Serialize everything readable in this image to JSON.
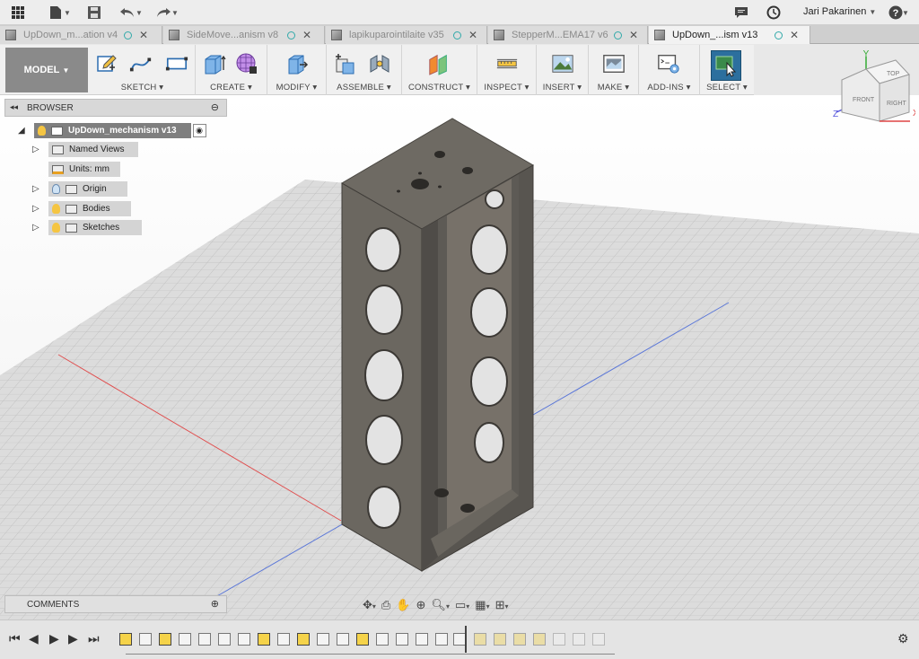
{
  "appbar": {
    "user_name": "Jari Pakarinen",
    "icons": [
      "grid-icon",
      "file-icon",
      "save-icon",
      "undo-icon",
      "redo-icon",
      "comment-icon",
      "clock-icon",
      "help-icon"
    ]
  },
  "tabs": [
    {
      "label": "UpDown_m...ation v4",
      "active": false
    },
    {
      "label": "SideMove...anism v8",
      "active": false
    },
    {
      "label": "lapikuparointilaite v35",
      "active": false
    },
    {
      "label": "StepperM...EMA17 v6",
      "active": false
    },
    {
      "label": "UpDown_...ism v13",
      "active": true
    }
  ],
  "toolbar": {
    "mode_label": "MODEL",
    "groups": [
      "SKETCH",
      "CREATE",
      "MODIFY",
      "ASSEMBLE",
      "CONSTRUCT",
      "INSPECT",
      "INSERT",
      "MAKE",
      "ADD-INS",
      "SELECT"
    ]
  },
  "browser": {
    "title": "BROWSER",
    "root": "UpDown_mechanism v13",
    "items": [
      "Named Views",
      "Units: mm",
      "Origin",
      "Bodies",
      "Sketches"
    ]
  },
  "comments": {
    "title": "COMMENTS"
  },
  "viewcube": {
    "top": "TOP",
    "front": "FRONT",
    "right": "RIGHT",
    "x": "X",
    "y": "Y",
    "z": "Z"
  }
}
